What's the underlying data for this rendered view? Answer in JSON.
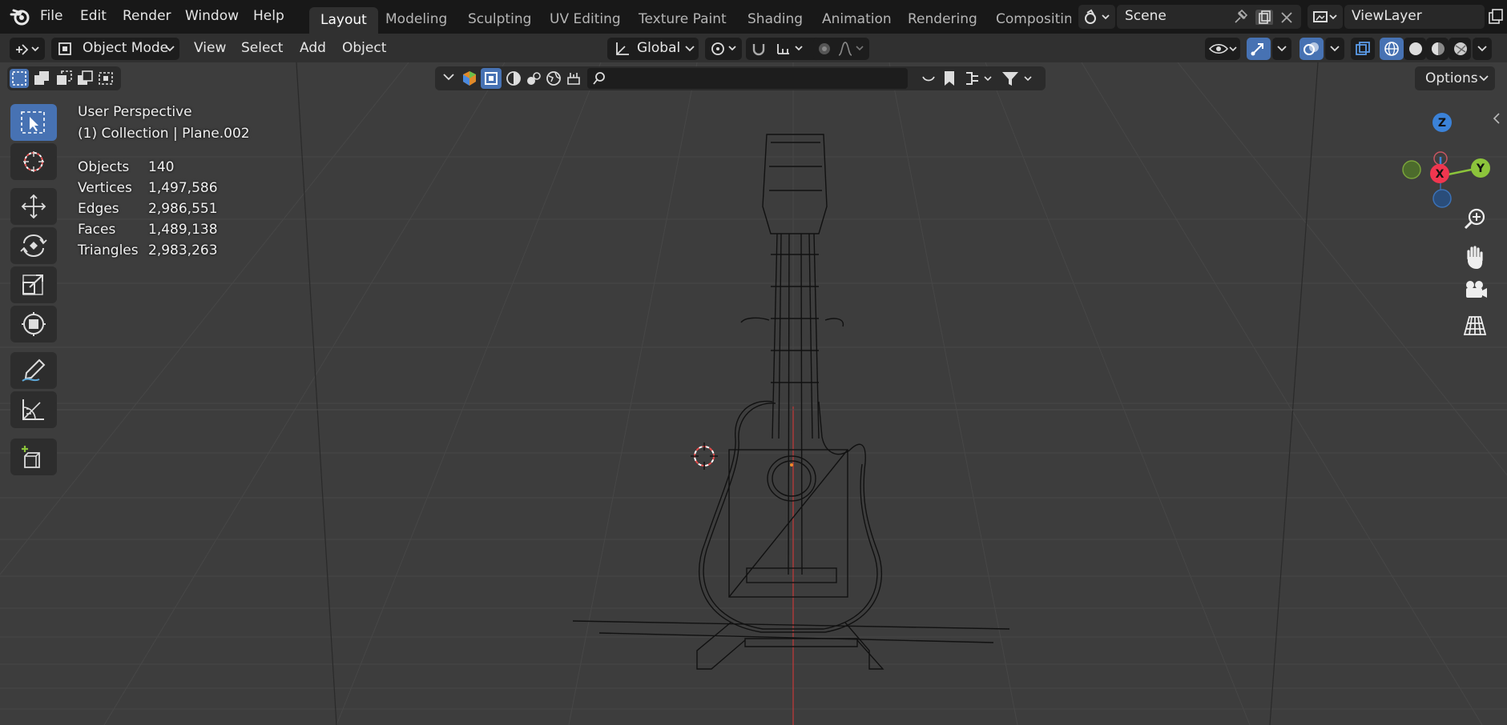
{
  "menubar": {
    "items": [
      "File",
      "Edit",
      "Render",
      "Window",
      "Help"
    ]
  },
  "workspaces": {
    "tabs": [
      "Layout",
      "Modeling",
      "Sculpting",
      "UV Editing",
      "Texture Paint",
      "Shading",
      "Animation",
      "Rendering",
      "Compositing"
    ],
    "active": "Layout"
  },
  "scene": {
    "name": "Scene"
  },
  "view_layer": {
    "name": "ViewLayer"
  },
  "header": {
    "mode": "Object Mode",
    "menus": [
      "View",
      "Select",
      "Add",
      "Object"
    ],
    "transform_orientation": "Global"
  },
  "viewport": {
    "view_name": "User Perspective",
    "collection_info": "(1) Collection | Plane.002",
    "options_label": "Options",
    "search_placeholder": "",
    "stats": [
      {
        "label": "Objects",
        "value": "140"
      },
      {
        "label": "Vertices",
        "value": "1,497,586"
      },
      {
        "label": "Edges",
        "value": "2,986,551"
      },
      {
        "label": "Faces",
        "value": "1,489,138"
      },
      {
        "label": "Triangles",
        "value": "2,983,263"
      }
    ]
  },
  "gizmo": {
    "z": "Z",
    "x": "X",
    "y": "Y"
  },
  "colors": {
    "accent": "#4772b3",
    "axis_x": "#f0364f",
    "axis_y": "#8cc43b",
    "axis_z": "#3b82d8",
    "background": "#3d3d3d"
  },
  "tools": [
    "select-box",
    "cursor",
    "move",
    "rotate",
    "scale",
    "transform",
    "annotate",
    "measure",
    "add-cube"
  ]
}
